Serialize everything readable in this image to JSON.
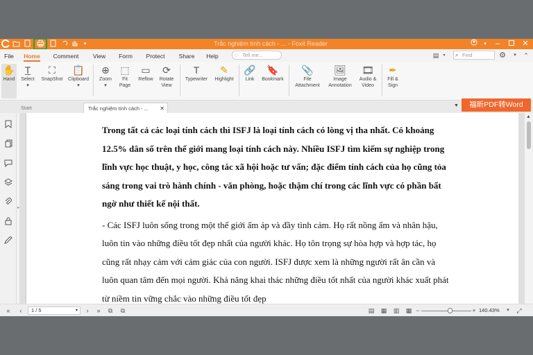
{
  "window": {
    "title": "Trắc nghiệm tính cách - ... - Foxit Reader"
  },
  "quick_access": [
    "foxit-logo-icon",
    "folder-icon",
    "page-icon",
    "print-icon",
    "page-icon-2",
    "undo-icon",
    "redo-icon",
    "hand-icon",
    "dropdown-icon"
  ],
  "menu": {
    "tabs": [
      "File",
      "Home",
      "Comment",
      "View",
      "Form",
      "Protect",
      "Share",
      "Help"
    ],
    "active_tab": "Home",
    "tell_me_placeholder": "Tell me...",
    "find_placeholder": "Find"
  },
  "ribbon": {
    "buttons": [
      {
        "label": "Hand",
        "icon": "hand-icon"
      },
      {
        "label": "Select",
        "icon": "select-text-icon"
      },
      {
        "label": "SnapShot",
        "icon": "snapshot-icon"
      },
      {
        "label": "Clipboard",
        "icon": "clipboard-icon"
      },
      {
        "label": "Zoom",
        "icon": "zoom-icon"
      },
      {
        "label": "Fit Page",
        "icon": "fit-page-icon"
      },
      {
        "label": "Reflow",
        "icon": "reflow-icon"
      },
      {
        "label": "Rotate View",
        "icon": "rotate-icon"
      },
      {
        "label": "Typewriter",
        "icon": "typewriter-icon"
      },
      {
        "label": "Highlight",
        "icon": "highlight-icon"
      },
      {
        "label": "Link",
        "icon": "link-icon"
      },
      {
        "label": "Bookmark",
        "icon": "bookmark-icon"
      },
      {
        "label": "File Attachment",
        "icon": "attachment-icon"
      },
      {
        "label": "Image Annotation",
        "icon": "image-icon"
      },
      {
        "label": "Audio & Video",
        "icon": "video-icon"
      },
      {
        "label": "Fill & Sign",
        "icon": "pen-icon"
      }
    ],
    "banner": "福昕PDF转Word"
  },
  "doc_tabs": {
    "start": "Start",
    "active": "Trắc nghiệm tính cách - ..."
  },
  "document": {
    "para1": "Trong tất cả các loại tính cách thì ISFJ là loại tính cách có lòng vị tha nhất. Có khoảng 12.5% dân số trên thế giới mang loại tính cách này. Nhiều ISFJ tìm kiếm sự nghiệp trong lĩnh vực học thuật, y học, công tác xã hội hoặc tư vấn; đặc điểm tính cách của họ cũng tỏa sáng trong vai trò hành chính - văn phòng, hoặc thậm chí trong các lĩnh vực có phần bất ngờ như thiết kế nội thất.",
    "para2": "- Các ISFJ luôn sống trong một thế giới ấm áp và đầy tình cảm. Họ rất nồng ấm và nhân hậu, luôn tin vào những điều tốt đẹp nhất của người khác. Họ tôn trọng sự hòa hợp và hợp tác, họ cũng rất nhạy cảm với cảm giác của con người. ISFJ được xem là những người rất ân cần và luôn quan tâm đến mọi người. Khả năng khai thác những điều tốt nhất của người khác xuất phát từ niềm tin vững chắc vào những điều tốt đẹp"
  },
  "status": {
    "page": "1 / 5",
    "zoom": "140.43%",
    "zoom_fraction": 0.5
  }
}
